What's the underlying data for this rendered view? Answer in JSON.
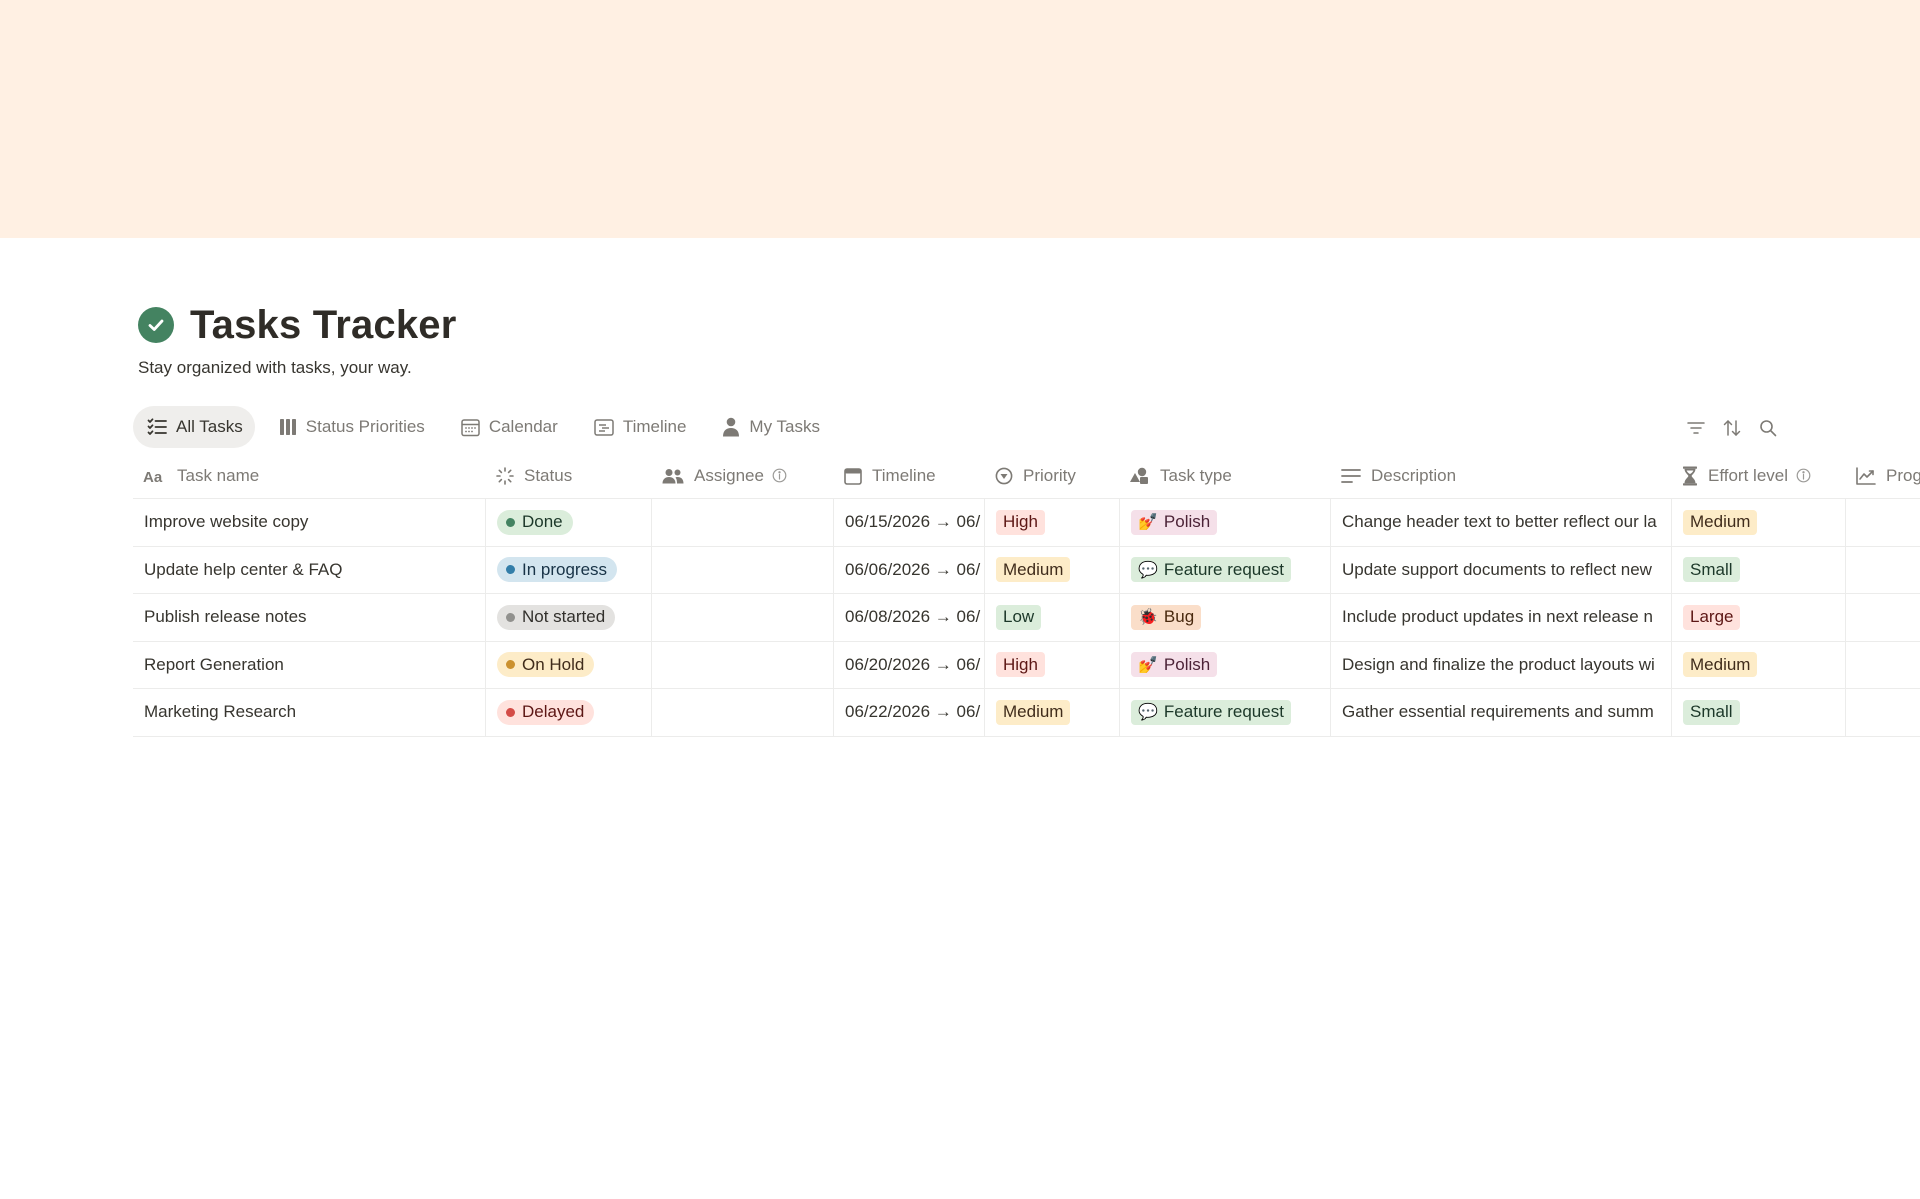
{
  "page": {
    "title": "Tasks Tracker",
    "subtitle": "Stay organized with tasks, your way.",
    "cover_color": "#fff0e3",
    "icon": "check-circle-icon"
  },
  "tabs": [
    {
      "label": "All Tasks",
      "icon": "checklist-icon",
      "active": true
    },
    {
      "label": "Status Priorities",
      "icon": "board-icon"
    },
    {
      "label": "Calendar",
      "icon": "calendar-icon"
    },
    {
      "label": "Timeline",
      "icon": "timeline-icon"
    },
    {
      "label": "My Tasks",
      "icon": "person-icon"
    }
  ],
  "toolbar": {
    "filter_icon": "filter-icon",
    "sort_icon": "sort-icon",
    "search_icon": "search-icon"
  },
  "table": {
    "columns": [
      {
        "label": "Task name",
        "icon": "text-aa-icon"
      },
      {
        "label": "Status",
        "icon": "status-spinner-icon"
      },
      {
        "label": "Assignee",
        "icon": "people-icon"
      },
      {
        "label": "Timeline",
        "icon": "calendar-icon"
      },
      {
        "label": "Priority",
        "icon": "priority-icon"
      },
      {
        "label": "Task type",
        "icon": "shapes-icon"
      },
      {
        "label": "Description",
        "icon": "lines-icon"
      },
      {
        "label": "Effort level",
        "icon": "hourglass-icon"
      },
      {
        "label": "Prog",
        "icon": "chart-line-icon"
      }
    ],
    "rows": [
      {
        "name": "Improve website copy",
        "status": "Done",
        "assignee": "",
        "timeline": "06/15/2026 → 06/",
        "priority": "High",
        "type": "Polish",
        "type_emoji": "💅",
        "description": "Change header text to better reflect our la",
        "effort": "Medium"
      },
      {
        "name": "Update help center & FAQ",
        "status": "In progress",
        "assignee": "",
        "timeline": "06/06/2026 → 06/",
        "priority": "Medium",
        "type": "Feature request",
        "type_emoji": "💬",
        "description": "Update support documents to reflect new",
        "effort": "Small"
      },
      {
        "name": "Publish release notes",
        "status": "Not started",
        "assignee": "",
        "timeline": "06/08/2026 → 06/",
        "priority": "Low",
        "type": "Bug",
        "type_emoji": "🐞",
        "description": "Include product updates in next release n",
        "effort": "Large"
      },
      {
        "name": "Report Generation",
        "status": "On Hold",
        "assignee": "",
        "timeline": "06/20/2026 → 06/",
        "priority": "High",
        "type": "Polish",
        "type_emoji": "💅",
        "description": "Design and finalize the product layouts wi",
        "effort": "Medium"
      },
      {
        "name": "Marketing Research",
        "status": "Delayed",
        "assignee": "",
        "timeline": "06/22/2026 → 06/",
        "priority": "Medium",
        "type": "Feature request",
        "type_emoji": "💬",
        "description": "Gather essential requirements and summ",
        "effort": "Small"
      }
    ]
  },
  "colors": {
    "status": {
      "Done": {
        "bg": "#dbeddb",
        "dot": "#448361",
        "fg": "#1c3829"
      },
      "In progress": {
        "bg": "#d3e5ef",
        "dot": "#337ea9",
        "fg": "#183347"
      },
      "Not started": {
        "bg": "#e3e2e0",
        "dot": "#91918e",
        "fg": "#32302c"
      },
      "On Hold": {
        "bg": "#fdecc8",
        "dot": "#cb912f",
        "fg": "#402c1b"
      },
      "Delayed": {
        "bg": "#ffe2dd",
        "dot": "#d44c47",
        "fg": "#5d1715"
      }
    },
    "priority": {
      "High": {
        "bg": "#ffe2dd",
        "fg": "#5d1715"
      },
      "Medium": {
        "bg": "#fdecc8",
        "fg": "#402c1b"
      },
      "Low": {
        "bg": "#dbeddb",
        "fg": "#1c3829"
      }
    },
    "type": {
      "Polish": {
        "bg": "#f5e0e9",
        "fg": "#4c2337"
      },
      "Feature request": {
        "bg": "#dbeddb",
        "fg": "#1c3829"
      },
      "Bug": {
        "bg": "#fadec9",
        "fg": "#49290e"
      }
    },
    "effort": {
      "Medium": {
        "bg": "#fdecc8",
        "fg": "#402c1b"
      },
      "Small": {
        "bg": "#dbeddb",
        "fg": "#1c3829"
      },
      "Large": {
        "bg": "#ffe2dd",
        "fg": "#5d1715"
      }
    }
  }
}
